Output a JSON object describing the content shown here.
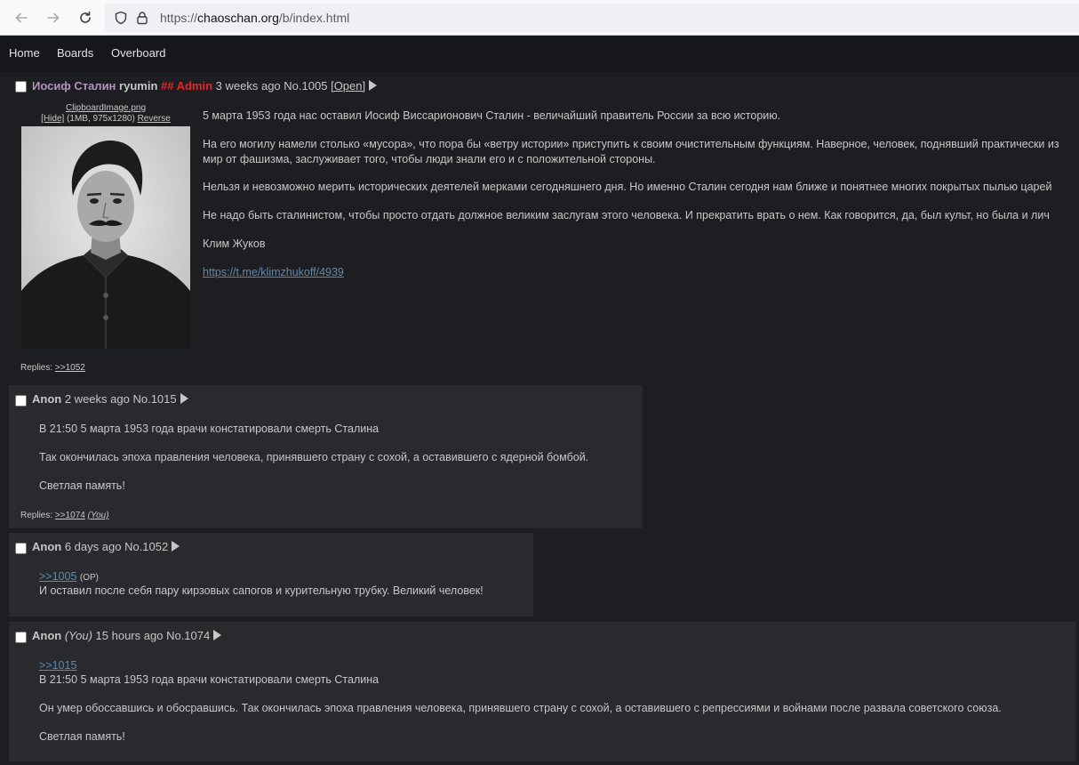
{
  "browser": {
    "url_scheme": "https://",
    "url_host": "chaoschan.org",
    "url_path": "/b/index.html"
  },
  "nav": {
    "home": "Home",
    "boards": "Boards",
    "overboard": "Overboard"
  },
  "thread": {
    "op": {
      "name": "Иосиф Сталин",
      "user": "ryumin",
      "capcode": "## Admin",
      "time": "3 weeks ago",
      "no": "No.1005",
      "open": "[Open]",
      "file_name": "ClipboardImage.png",
      "file_hide": "[Hide]",
      "file_meta": "(1MB, 975x1280)",
      "file_reverse": "Reverse",
      "lines": [
        "5 марта 1953 года нас оставил Иосиф Виссарионович Сталин - величайший правитель России за всю историю.",
        "На его могилу намели столько «мусора», что пора бы «ветру истории» приступить к своим очистительным функциям. Наверное, человек, поднявший практически из",
        "мир от фашизма, заслуживает того, чтобы люди знали его и с положительной стороны.",
        "Нельзя и невозможно мерить исторических деятелей мерками сегодняшнего дня. Но именно Сталин сегодня нам ближе и понятнее многих покрытых пылью царей",
        "Не надо быть сталинистом, чтобы просто отдать должное великим заслугам этого человека. И прекратить врать о нем. Как говорится, да, был культ, но была и лич",
        "Клим Жуков"
      ],
      "link": "https://t.me/klimzhukoff/4939",
      "replies_label": "Replies:",
      "replies": ">>1052"
    },
    "replies": [
      {
        "name": "Anon",
        "time": "2 weeks ago",
        "no": "No.1015",
        "lines": [
          "В 21:50 5 марта 1953 года врачи констатировали смерть Сталина",
          "Так окончилась эпоха правления человека, принявшего страну с сохой, а оставившего с ядерной бомбой.",
          "Светлая память!"
        ],
        "replies_label": "Replies:",
        "replies": ">>1074",
        "replies_you": "(You)"
      },
      {
        "name": "Anon",
        "time": "6 days ago",
        "no": "No.1052",
        "quote": ">>1005",
        "quote_note": "(OP)",
        "lines": [
          "И оставил после себя пару кирзовых сапогов и курительную трубку. Великий человек!"
        ]
      },
      {
        "name": "Anon",
        "you": "(You)",
        "time": "15 hours ago",
        "no": "No.1074",
        "quote": ">>1015",
        "lines": [
          "В 21:50 5 марта 1953 года врачи констатировали смерть Сталина",
          "Он умер обоссавшись и обосравшись. Так окончилась эпоха правления человека, принявшего страну с сохой, а оставившего с репрессиями и войнами после развала советского союза.",
          "Светлая память!"
        ]
      }
    ]
  }
}
